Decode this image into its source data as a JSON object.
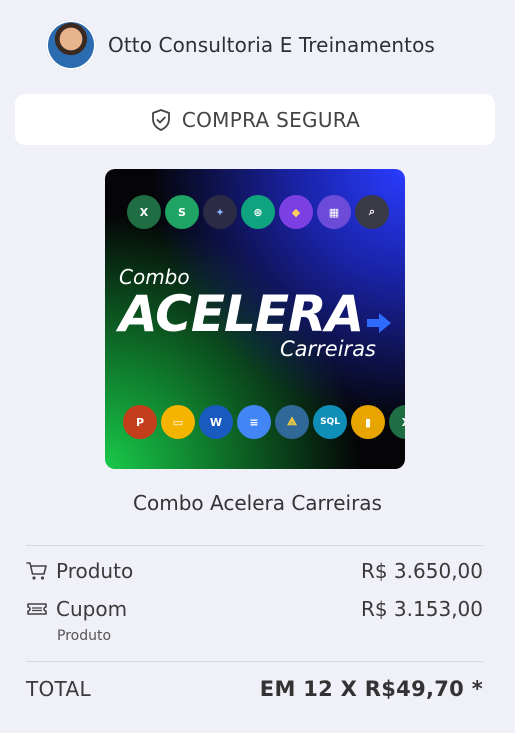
{
  "seller": {
    "name": "Otto Consultoria E Treinamentos"
  },
  "secure_badge": {
    "label": "COMPRA SEGURA"
  },
  "product_image": {
    "combo_text": "Combo",
    "main_text": "ACELERA",
    "sub_text": "Carreiras",
    "top_icons": [
      "X",
      "S",
      "✦",
      "⊛",
      "◆",
      "▦",
      "⌕"
    ],
    "bottom_icons": [
      "P",
      "▭",
      "W",
      "≡",
      "⟁",
      "SQL",
      "▮",
      "X"
    ]
  },
  "product": {
    "name": "Combo Acelera Carreiras"
  },
  "summary": {
    "product_label": "Produto",
    "product_price": "R$ 3.650,00",
    "coupon_label": "Cupom",
    "coupon_price": "R$ 3.153,00",
    "coupon_sub": "Produto",
    "total_label": "TOTAL",
    "total_value": "EM 12 X R$49,70 *"
  },
  "colors": {
    "background": "#f0f0f8",
    "image_blue": "#2a3cff",
    "image_green": "#19c94a"
  }
}
